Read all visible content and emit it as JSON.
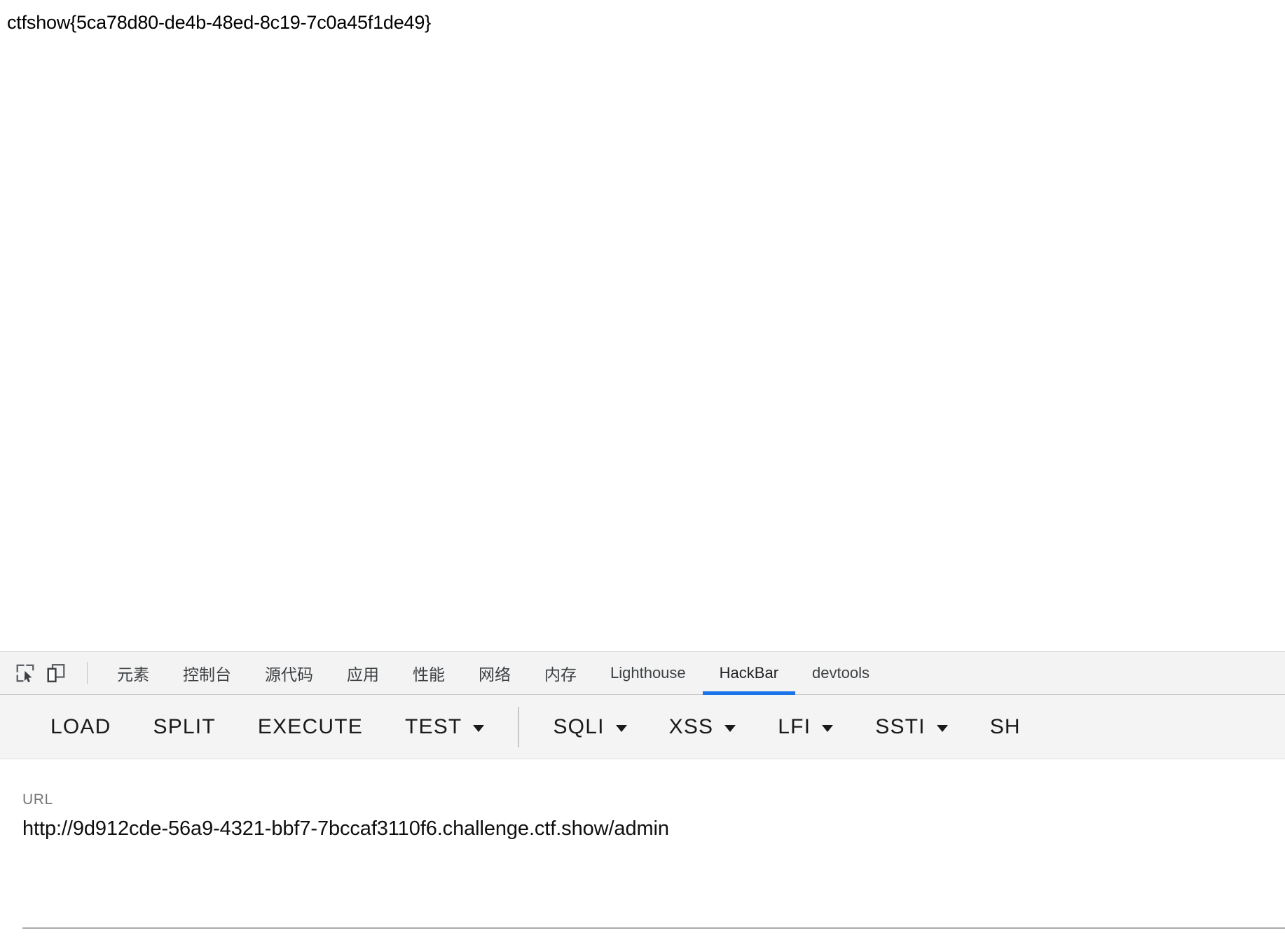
{
  "page": {
    "flag_text": "ctfshow{5ca78d80-de4b-48ed-8c19-7c0a45f1de49}"
  },
  "devtools": {
    "toolbar_icons": [
      {
        "name": "inspect-element-icon",
        "label": "Inspect element"
      },
      {
        "name": "device-toolbar-icon",
        "label": "Toggle device toolbar"
      }
    ],
    "tabs": [
      {
        "label": "元素",
        "active": false
      },
      {
        "label": "控制台",
        "active": false
      },
      {
        "label": "源代码",
        "active": false
      },
      {
        "label": "应用",
        "active": false
      },
      {
        "label": "性能",
        "active": false
      },
      {
        "label": "网络",
        "active": false
      },
      {
        "label": "内存",
        "active": false
      },
      {
        "label": "Lighthouse",
        "active": false
      },
      {
        "label": "HackBar",
        "active": true
      },
      {
        "label": "devtools",
        "active": false
      }
    ],
    "active_tab": "HackBar",
    "accent_color": "#1a73e8"
  },
  "hackbar": {
    "buttons": [
      {
        "label": "LOAD",
        "has_dropdown": false
      },
      {
        "label": "SPLIT",
        "has_dropdown": false
      },
      {
        "label": "EXECUTE",
        "has_dropdown": false
      },
      {
        "label": "TEST",
        "has_dropdown": true
      },
      {
        "label": "SQLI",
        "has_dropdown": true
      },
      {
        "label": "XSS",
        "has_dropdown": true
      },
      {
        "label": "LFI",
        "has_dropdown": true
      },
      {
        "label": "SSTI",
        "has_dropdown": true
      },
      {
        "label": "SH",
        "has_dropdown": false
      }
    ],
    "url": {
      "label": "URL",
      "value": "http://9d912cde-56a9-4321-bbf7-7bccaf3110f6.challenge.ctf.show/admin",
      "placeholder": "URL"
    }
  }
}
